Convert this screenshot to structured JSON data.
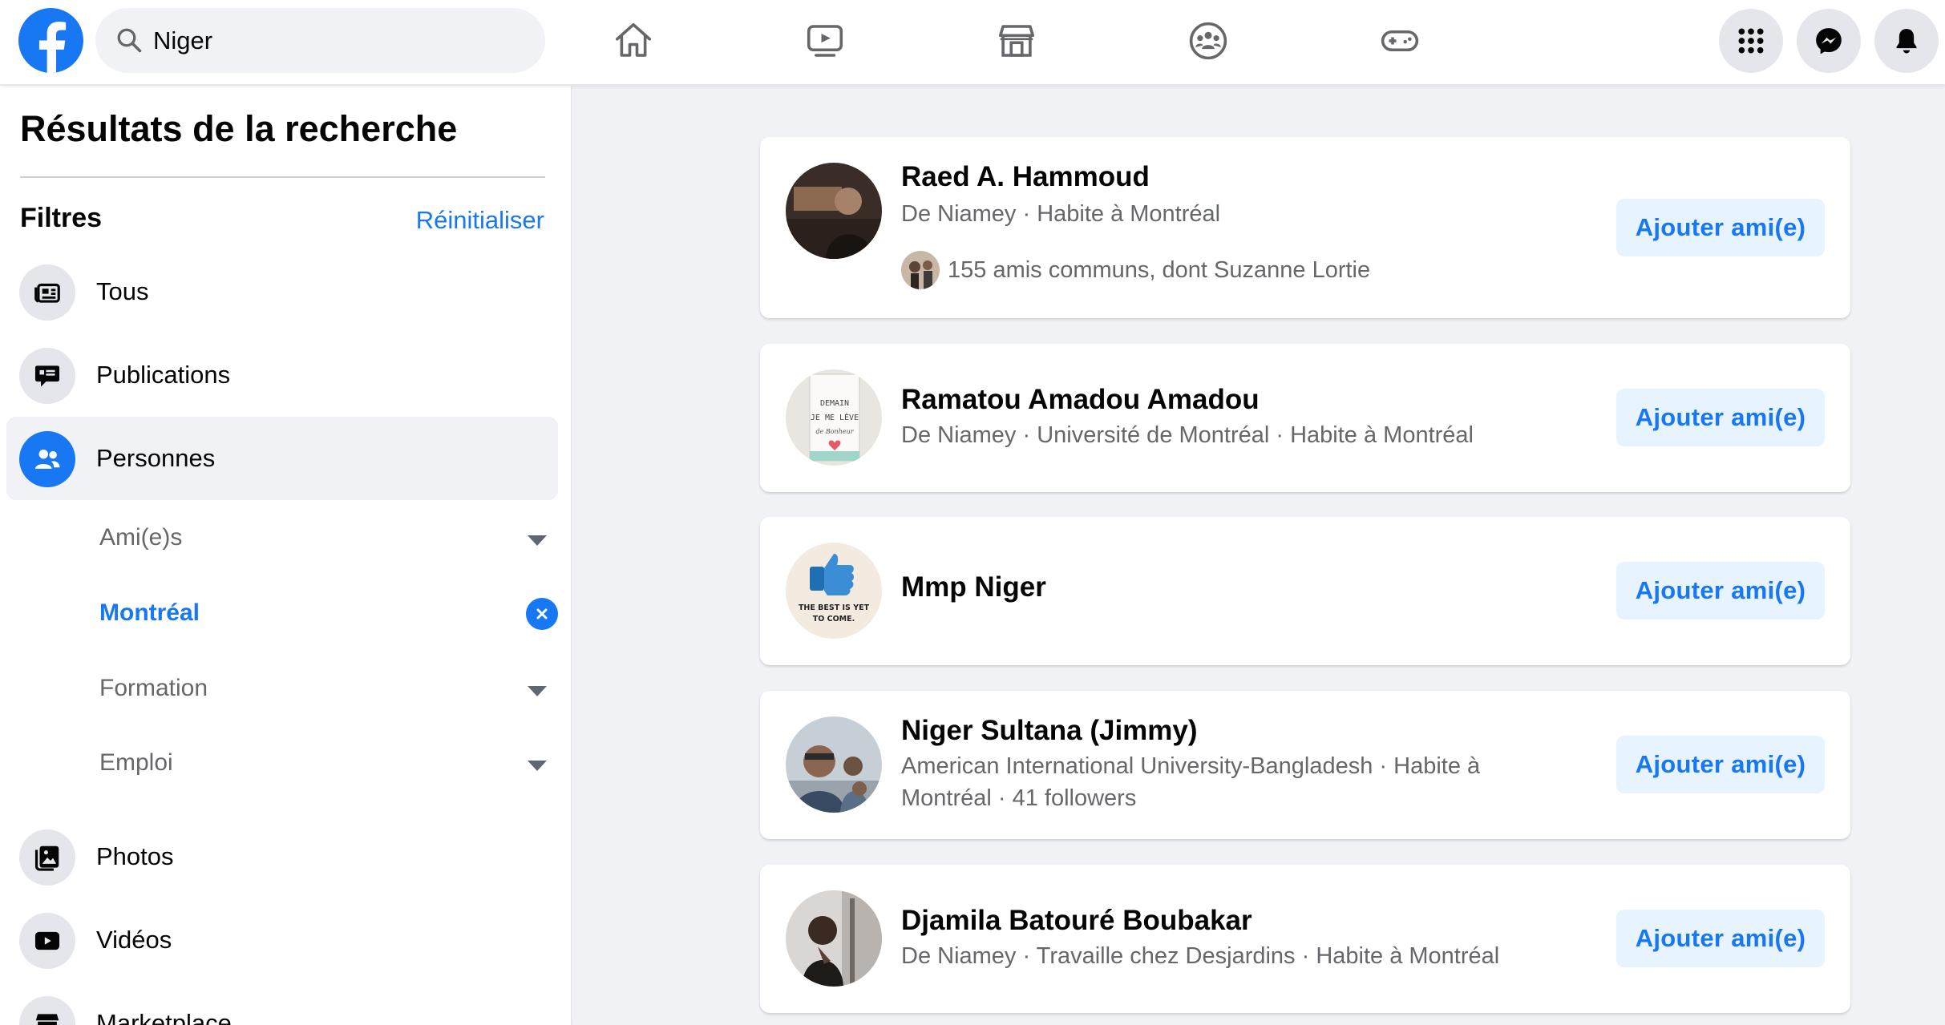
{
  "search": {
    "value": "Niger"
  },
  "sidebar": {
    "title": "Résultats de la recherche",
    "filters_label": "Filtres",
    "reset_label": "Réinitialiser",
    "items": [
      {
        "label": "Tous",
        "icon": "search-results-icon"
      },
      {
        "label": "Publications",
        "icon": "posts-icon"
      },
      {
        "label": "Personnes",
        "icon": "people-icon",
        "active": true
      },
      {
        "label": "Photos",
        "icon": "photos-icon"
      },
      {
        "label": "Vidéos",
        "icon": "video-icon"
      },
      {
        "label": "Marketplace",
        "icon": "marketplace-icon"
      }
    ],
    "subfilters": [
      {
        "label": "Ami(e)s"
      },
      {
        "label": "Montréal",
        "selected": true
      },
      {
        "label": "Formation"
      },
      {
        "label": "Emploi"
      }
    ]
  },
  "results": [
    {
      "name": "Raed A. Hammoud",
      "meta": "De Niamey · Habite à Montréal",
      "mutual": "155 amis communs, dont Suzanne Lortie",
      "button": "Ajouter ami(e)"
    },
    {
      "name": "Ramatou Amadou Amadou",
      "meta": "De Niamey · Université de Montréal · Habite à Montréal",
      "avatar_text": [
        "DEMAIN",
        "JE ME LÈVE",
        "de Bonheur"
      ],
      "button": "Ajouter ami(e)"
    },
    {
      "name": "Mmp Niger",
      "avatar_text": [
        "THE BEST IS YET",
        "TO COME."
      ],
      "button": "Ajouter ami(e)"
    },
    {
      "name": "Niger Sultana (Jimmy)",
      "meta": "American International University-Bangladesh · Habite à Montréal · 41 followers",
      "button": "Ajouter ami(e)"
    },
    {
      "name": "Djamila Batouré Boubakar",
      "meta": "De Niamey · Travaille chez Desjardins · Habite à Montréal",
      "button": "Ajouter ami(e)"
    }
  ],
  "colors": {
    "brand": "#1877f2",
    "button_bg": "#e7f3ff",
    "page_bg": "#f0f2f5",
    "secondary_text": "#65676b"
  }
}
